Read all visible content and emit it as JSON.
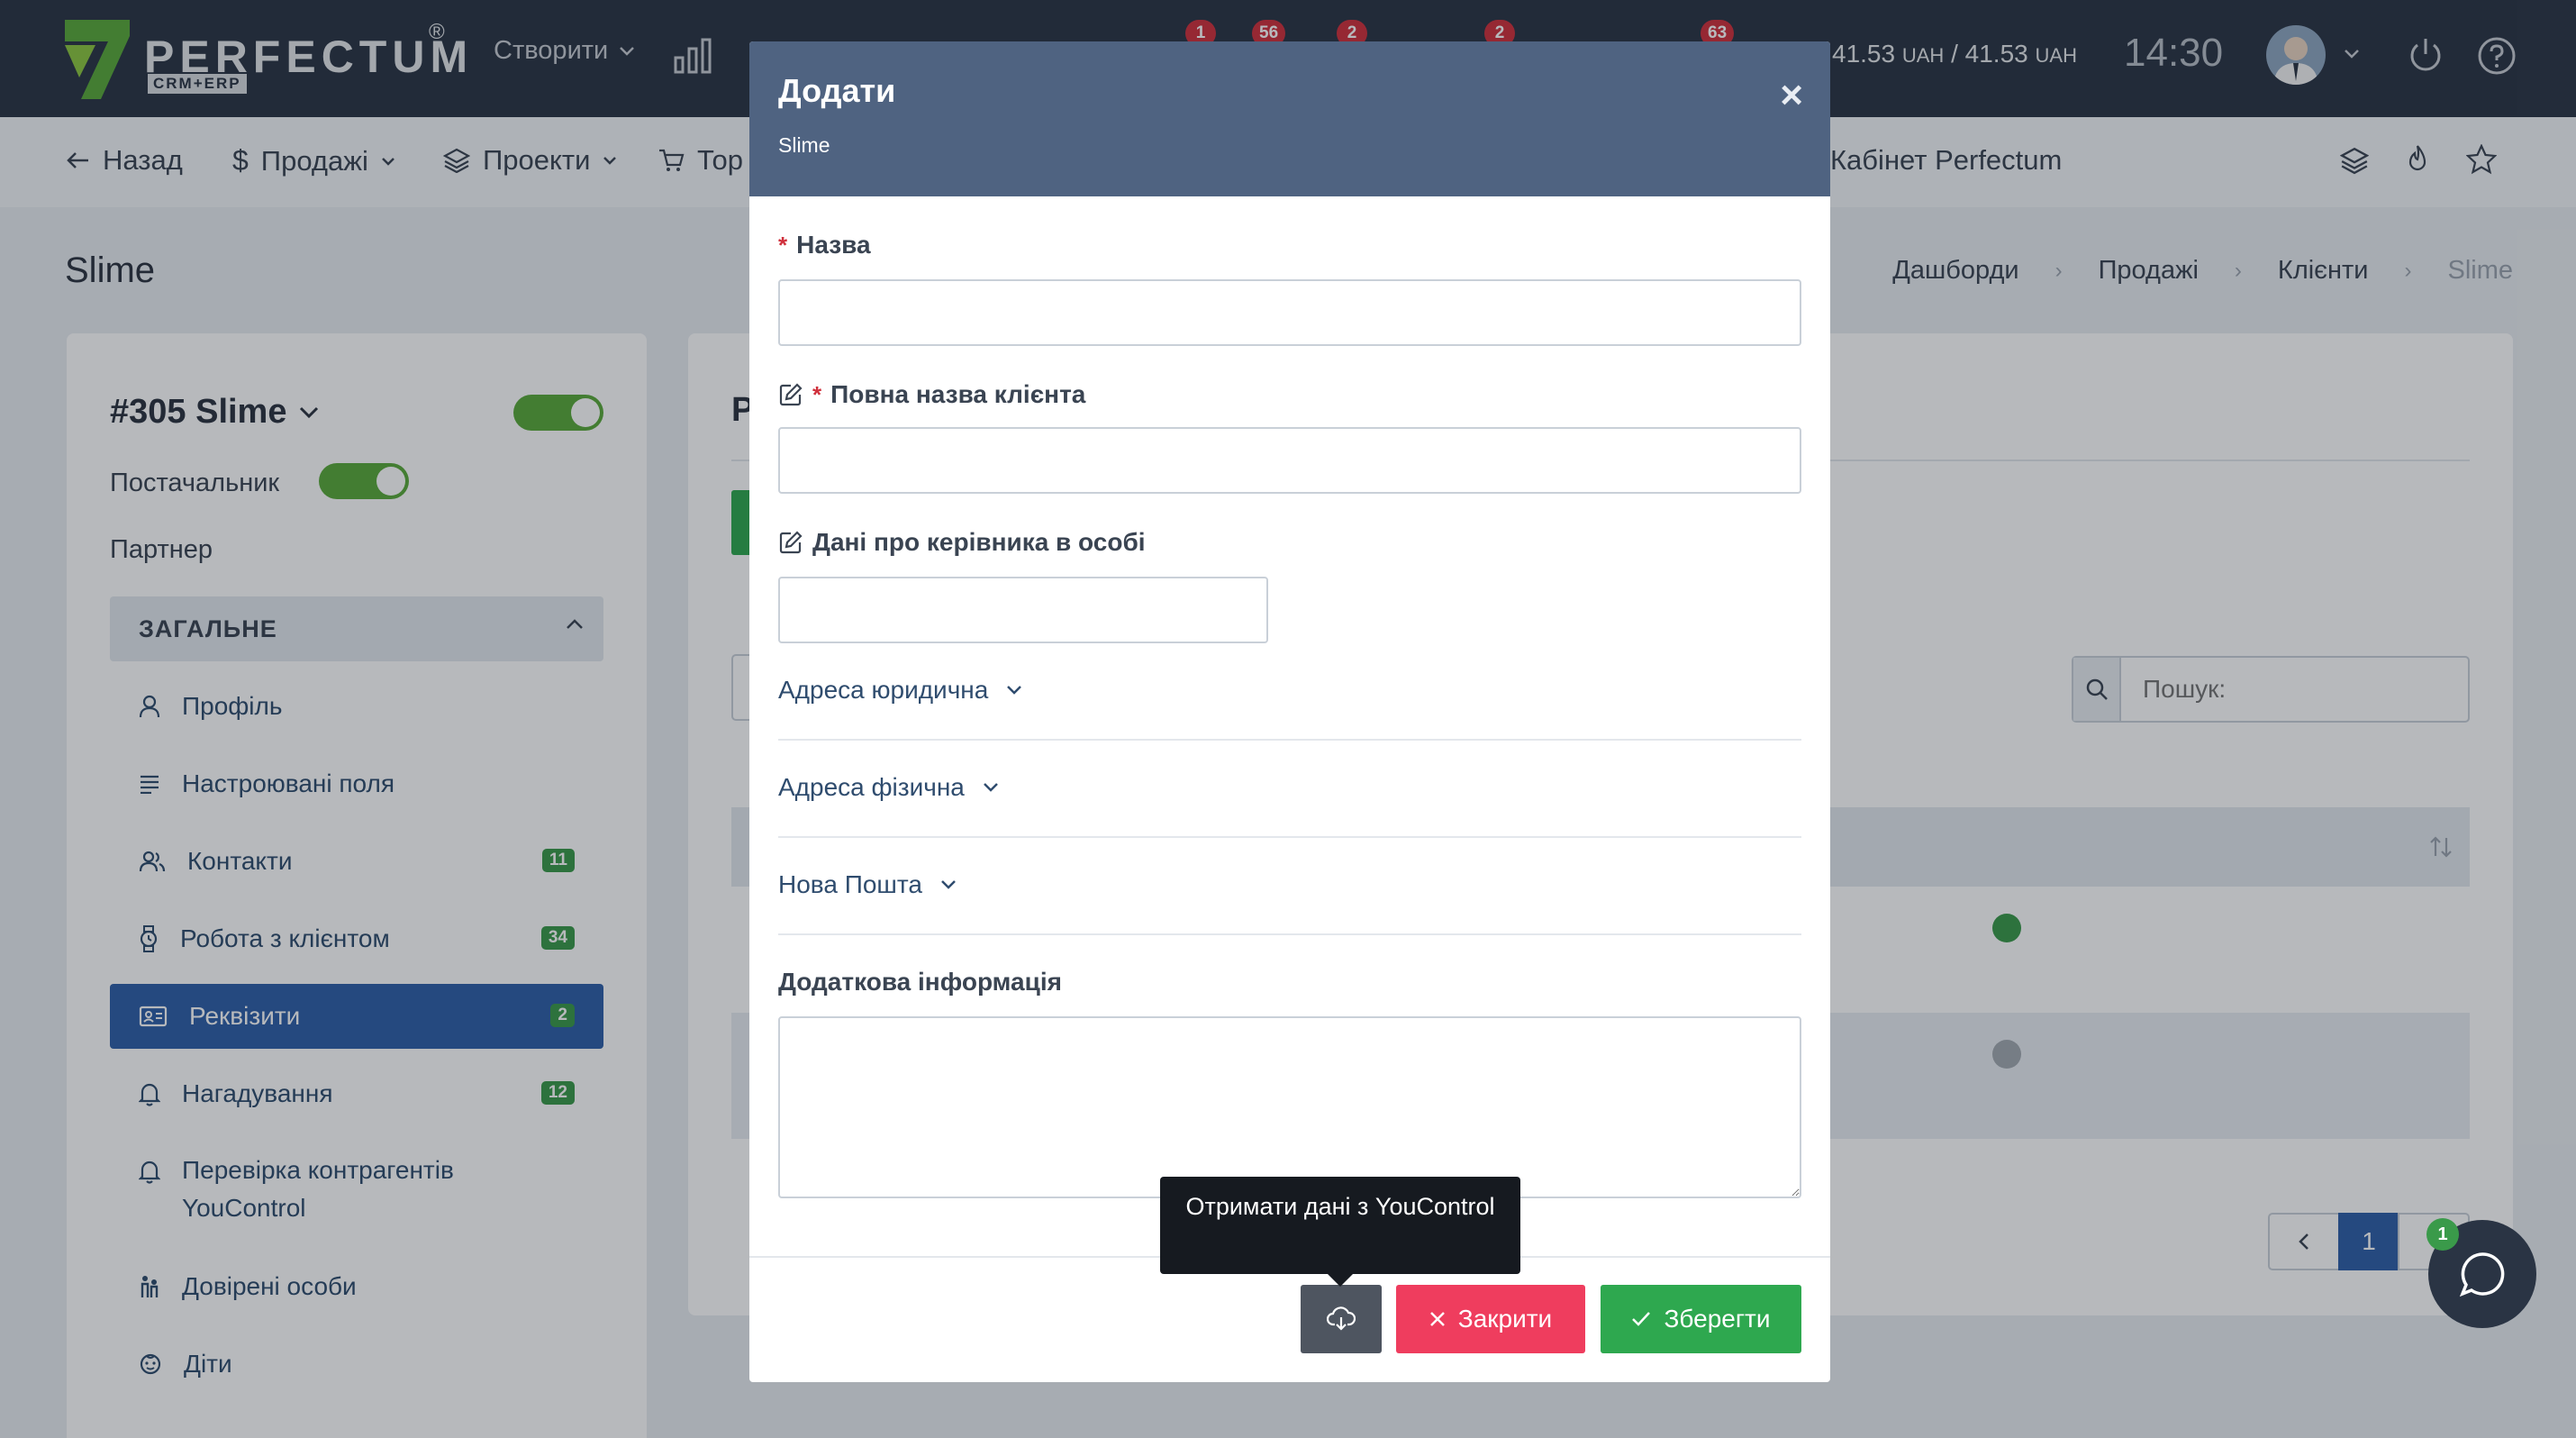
{
  "app": {
    "logo_text": "PERFECTUM",
    "logo_reg": "®",
    "logo_sub": "CRM+ERP"
  },
  "topbar": {
    "create_label": "Створити",
    "badges": [
      "1",
      "56",
      "2",
      "2",
      "63"
    ],
    "balance_value1": "41.53",
    "balance_currency1": "UAH",
    "balance_value2": "41.53",
    "balance_currency2": "UAH",
    "balance_sep": "/",
    "time": "14:30"
  },
  "nav": {
    "back": "Назад",
    "sales": "Продажі",
    "projects": "Проекти",
    "trade": "Тор",
    "cabinet": "Кабінет Perfectum"
  },
  "page": {
    "title": "Slime",
    "breadcrumbs": [
      "Дашборди",
      "Продажі",
      "Клієнти",
      "Slime"
    ]
  },
  "sidebar": {
    "client_name": "#305 Slime",
    "supplier_label": "Постачальник",
    "partner_label": "Партнер",
    "section_title": "ЗАГАЛЬНЕ",
    "items": [
      {
        "label": "Профіль",
        "icon": "user-icon"
      },
      {
        "label": "Настроювані поля",
        "icon": "lines-icon"
      },
      {
        "label": "Контакти",
        "icon": "users-icon",
        "count": "11"
      },
      {
        "label": "Робота з клієнтом",
        "icon": "watch-icon",
        "count": "34"
      },
      {
        "label": "Реквізити",
        "icon": "id-card-icon",
        "count": "2",
        "active": true
      },
      {
        "label": "Нагадування",
        "icon": "bell-icon",
        "count": "12"
      },
      {
        "label": "Перевірка контрагентів YouControl",
        "icon": "bell-icon"
      },
      {
        "label": "Довірені особи",
        "icon": "people-icon"
      },
      {
        "label": "Діти",
        "icon": "child-icon"
      }
    ]
  },
  "main": {
    "heading_letter": "Р",
    "search_placeholder": "Пошук:",
    "page_current": "1",
    "status_colors": [
      "#3a9a4a",
      "#a3a9b1"
    ]
  },
  "modal": {
    "title": "Додати",
    "subtitle": "Slime",
    "close": "×",
    "fields": {
      "name_label": "Назва",
      "full_name_label": "Повна назва клієнта",
      "director_label": "Дані про керівника в особі",
      "legal_address": "Адреса юридична",
      "physical_address": "Адреса фізична",
      "nova_poshta": "Нова Пошта",
      "extra_info_label": "Додаткова інформація",
      "required_mark": "*"
    },
    "tooltip": "Отримати дані з YouControl",
    "buttons": {
      "close": "Закрити",
      "save": "Зберегти"
    }
  },
  "chat": {
    "badge": "1"
  },
  "colors": {
    "header_bg": "#2a3444",
    "modal_header": "#4f6381",
    "active_item": "#2e5fa8",
    "danger": "#ef3d5e",
    "success": "#2ea84f"
  }
}
